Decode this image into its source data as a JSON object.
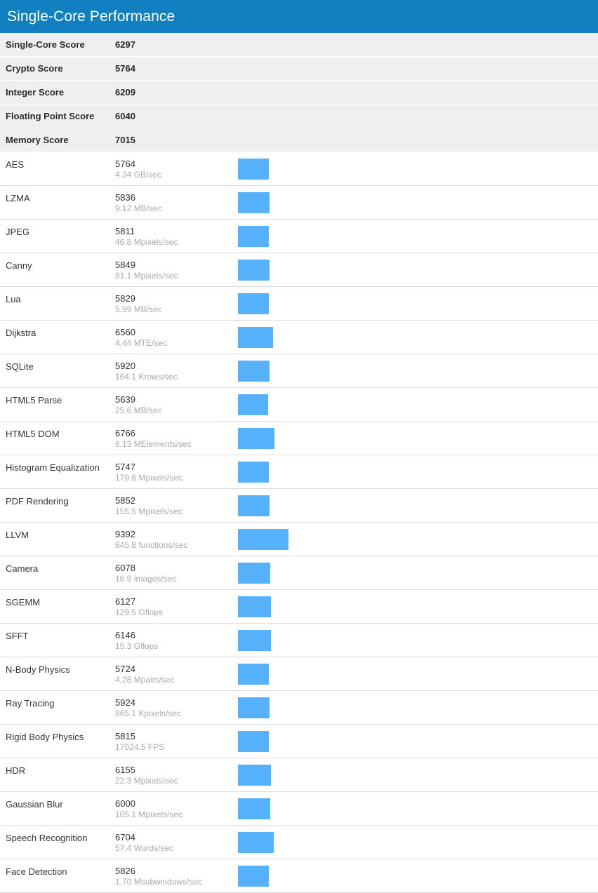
{
  "header": {
    "title": "Single-Core Performance",
    "background_color": "#1180c0",
    "text_color": "#ffffff"
  },
  "colors": {
    "bar": "#55b2fa",
    "summary_row_background": "#efefef",
    "row_divider": "#dddddd",
    "rate_text": "#aaaaaa",
    "primary_text": "#333333"
  },
  "summary": [
    {
      "label": "Single-Core Score",
      "value": "6297"
    },
    {
      "label": "Crypto Score",
      "value": "5764"
    },
    {
      "label": "Integer Score",
      "value": "6209"
    },
    {
      "label": "Floating Point Score",
      "value": "6040"
    },
    {
      "label": "Memory Score",
      "value": "7015"
    }
  ],
  "benchmarks": [
    {
      "name": "AES",
      "score": "5764",
      "rate": "4.34 GB/sec",
      "value": 5764
    },
    {
      "name": "LZMA",
      "score": "5836",
      "rate": "9.12 MB/sec",
      "value": 5836
    },
    {
      "name": "JPEG",
      "score": "5811",
      "rate": "46.8 Mpixels/sec",
      "value": 5811
    },
    {
      "name": "Canny",
      "score": "5849",
      "rate": "81.1 Mpixels/sec",
      "value": 5849
    },
    {
      "name": "Lua",
      "score": "5829",
      "rate": "5.99 MB/sec",
      "value": 5829
    },
    {
      "name": "Dijkstra",
      "score": "6560",
      "rate": "4.44 MTE/sec",
      "value": 6560
    },
    {
      "name": "SQLite",
      "score": "5920",
      "rate": "164.1 Krows/sec",
      "value": 5920
    },
    {
      "name": "HTML5 Parse",
      "score": "5639",
      "rate": "25.6 MB/sec",
      "value": 5639
    },
    {
      "name": "HTML5 DOM",
      "score": "6766",
      "rate": "6.13 MElements/sec",
      "value": 6766
    },
    {
      "name": "Histogram Equalization",
      "score": "5747",
      "rate": "179.6 Mpixels/sec",
      "value": 5747
    },
    {
      "name": "PDF Rendering",
      "score": "5852",
      "rate": "155.5 Mpixels/sec",
      "value": 5852
    },
    {
      "name": "LLVM",
      "score": "9392",
      "rate": "645.8 functions/sec",
      "value": 9392
    },
    {
      "name": "Camera",
      "score": "6078",
      "rate": "16.9 images/sec",
      "value": 6078
    },
    {
      "name": "SGEMM",
      "score": "6127",
      "rate": "129.5 Gflops",
      "value": 6127
    },
    {
      "name": "SFFT",
      "score": "6146",
      "rate": "15.3 Gflops",
      "value": 6146
    },
    {
      "name": "N-Body Physics",
      "score": "5724",
      "rate": "4.28 Mpairs/sec",
      "value": 5724
    },
    {
      "name": "Ray Tracing",
      "score": "5924",
      "rate": "865.1 Kpixels/sec",
      "value": 5924
    },
    {
      "name": "Rigid Body Physics",
      "score": "5815",
      "rate": "17024.5 FPS",
      "value": 5815
    },
    {
      "name": "HDR",
      "score": "6155",
      "rate": "22.3 Mpixels/sec",
      "value": 6155
    },
    {
      "name": "Gaussian Blur",
      "score": "6000",
      "rate": "105.1 Mpixels/sec",
      "value": 6000
    },
    {
      "name": "Speech Recognition",
      "score": "6704",
      "rate": "57.4 Words/sec",
      "value": 6704
    },
    {
      "name": "Face Detection",
      "score": "5826",
      "rate": "1.70 Msubwindows/sec",
      "value": 5826
    }
  ],
  "chart_data": {
    "type": "bar",
    "title": "Single-Core Performance",
    "orientation": "horizontal",
    "xlabel": "",
    "ylabel": "",
    "categories": [
      "AES",
      "LZMA",
      "JPEG",
      "Canny",
      "Lua",
      "Dijkstra",
      "SQLite",
      "HTML5 Parse",
      "HTML5 DOM",
      "Histogram Equalization",
      "PDF Rendering",
      "LLVM",
      "Camera",
      "SGEMM",
      "SFFT",
      "N-Body Physics",
      "Ray Tracing",
      "Rigid Body Physics",
      "HDR",
      "Gaussian Blur",
      "Speech Recognition",
      "Face Detection"
    ],
    "values": [
      5764,
      5836,
      5811,
      5849,
      5829,
      6560,
      5920,
      5639,
      6766,
      5747,
      5852,
      9392,
      6078,
      6127,
      6146,
      5724,
      5924,
      5815,
      6155,
      6000,
      6704,
      5826
    ],
    "rates": [
      "4.34 GB/sec",
      "9.12 MB/sec",
      "46.8 Mpixels/sec",
      "81.1 Mpixels/sec",
      "5.99 MB/sec",
      "4.44 MTE/sec",
      "164.1 Krows/sec",
      "25.6 MB/sec",
      "6.13 MElements/sec",
      "179.6 Mpixels/sec",
      "155.5 Mpixels/sec",
      "645.8 functions/sec",
      "16.9 images/sec",
      "129.5 Gflops",
      "15.3 Gflops",
      "4.28 Mpairs/sec",
      "865.1 Kpixels/sec",
      "17024.5 FPS",
      "22.3 Mpixels/sec",
      "105.1 Mpixels/sec",
      "57.4 Words/sec",
      "1.70 Msubwindows/sec"
    ],
    "summary_scores": {
      "Single-Core Score": 6297,
      "Crypto Score": 5764,
      "Integer Score": 6209,
      "Floating Point Score": 6040,
      "Memory Score": 7015
    },
    "grid": false,
    "legend": "none",
    "bar_color": "#55b2fa",
    "points_per_pixel": 131
  }
}
